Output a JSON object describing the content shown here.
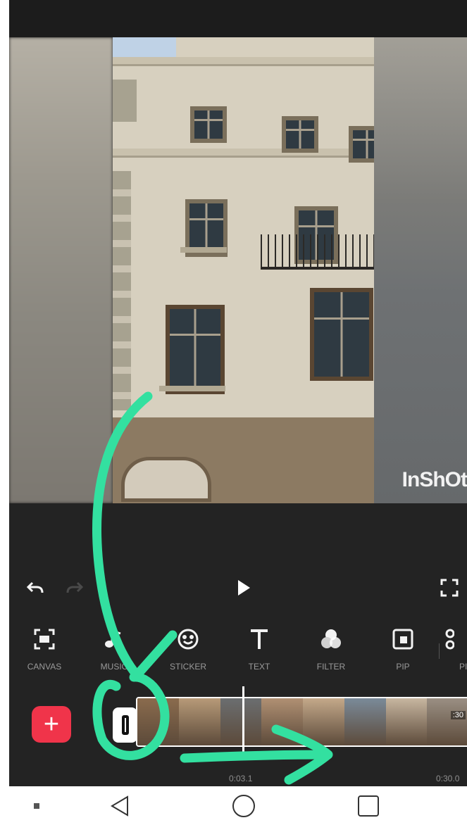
{
  "editor": {
    "watermark": "InShOt",
    "controls": {
      "undo_icon": "undo-arrow-icon",
      "redo_icon": "redo-arrow-icon",
      "play_icon": "play-triangle-icon",
      "fullscreen_icon": "fullscreen-corners-icon"
    },
    "toolbar": [
      {
        "id": "canvas",
        "label": "CANVAS",
        "icon": "canvas-frame-icon"
      },
      {
        "id": "music",
        "label": "MUSIC",
        "icon": "music-note-icon"
      },
      {
        "id": "sticker",
        "label": "STICKER",
        "icon": "smiley-icon"
      },
      {
        "id": "text",
        "label": "TEXT",
        "icon": "text-t-icon"
      },
      {
        "id": "filter",
        "label": "FILTER",
        "icon": "filter-circles-icon"
      },
      {
        "id": "pip",
        "label": "PIP",
        "icon": "pip-square-icon"
      },
      {
        "id": "precut",
        "label": "PI",
        "icon": "scissors-icon"
      }
    ],
    "timeline": {
      "add_symbol": "+",
      "mute_icon": "mute-toggle-icon",
      "current_time": "0:03.1",
      "total_time": "0:30.0",
      "clip_duration": ":30",
      "thumbnail_colors": [
        "#8a6b4d",
        "#b79a78",
        "#6b6e70",
        "#b09073",
        "#c4a98a",
        "#7a8a99",
        "#c7b6a0",
        "#9a8f83"
      ]
    }
  },
  "annotation": {
    "color": "#33e0a0"
  },
  "system_nav": {
    "menu_icon": "recent-dot-icon",
    "back_icon": "back-triangle-icon",
    "home_icon": "home-circle-icon",
    "recents_icon": "recents-square-icon"
  }
}
